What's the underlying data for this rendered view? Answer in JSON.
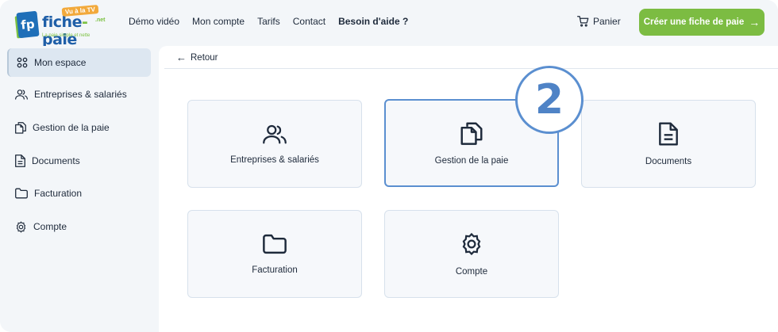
{
  "logo": {
    "tv_badge": "Vu à la TV",
    "brand_part1": "fiche",
    "brand_dash": "-",
    "brand_part2": "paie",
    "net": ".net",
    "tagline": "La paie simple et nette",
    "fp": "fp"
  },
  "nav": {
    "items": [
      "Démo vidéo",
      "Mon compte",
      "Tarifs",
      "Contact"
    ],
    "help": "Besoin d'aide ?"
  },
  "cart": {
    "label": "Panier"
  },
  "cta": {
    "label": "Créer une fiche de paie",
    "arrow": "→"
  },
  "sidebar": {
    "items": [
      {
        "label": "Mon espace",
        "icon": "grid-icon",
        "active": true
      },
      {
        "label": "Entreprises & salariés",
        "icon": "users-icon"
      },
      {
        "label": "Gestion de la paie",
        "icon": "files-icon"
      },
      {
        "label": "Documents",
        "icon": "document-icon"
      },
      {
        "label": "Facturation",
        "icon": "folder-icon"
      },
      {
        "label": "Compte",
        "icon": "gear-icon"
      }
    ]
  },
  "main": {
    "back_label": "Retour",
    "back_arrow": "←",
    "step_badge": "2",
    "cards": [
      {
        "label": "Entreprises & salariés",
        "icon": "users-icon"
      },
      {
        "label": "Gestion de la paie",
        "icon": "files-icon",
        "highlighted": true
      },
      {
        "label": "Documents",
        "icon": "document-icon"
      },
      {
        "label": "Facturation",
        "icon": "folder-icon"
      },
      {
        "label": "Compte",
        "icon": "gear-icon"
      }
    ]
  },
  "colors": {
    "accent_green": "#7cbc42",
    "highlight_blue": "#5b8fd0",
    "text": "#1e2a3b",
    "brand_blue": "#1f5fa8"
  }
}
